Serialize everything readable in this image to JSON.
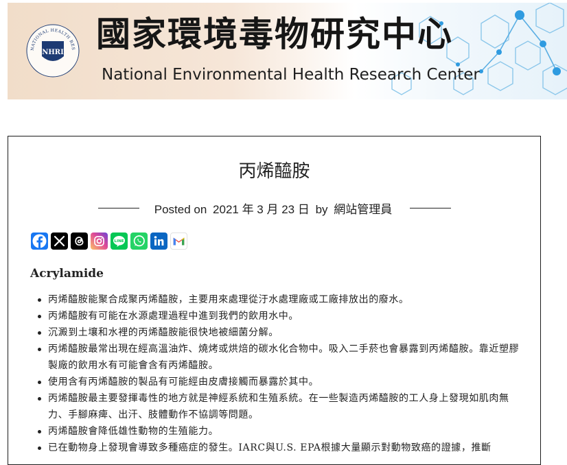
{
  "header": {
    "title_zh": "國家環境毒物研究中心",
    "title_en": "National Environmental Health Research Center",
    "logo": {
      "ring_text": "NATIONAL HEALTH RESEARCH INSTITUTES",
      "monogram": "NHRI",
      "icon": "institute-seal-icon"
    }
  },
  "post": {
    "title": "丙烯醯胺",
    "meta": {
      "posted_on": "Posted on",
      "date": "2021 年 3 月 23 日",
      "by": "by",
      "author": "網站管理員"
    },
    "share_buttons": [
      {
        "name": "facebook",
        "icon": "facebook-icon",
        "color": "#1877f2",
        "glyph": "f"
      },
      {
        "name": "x",
        "icon": "x-icon",
        "color": "#000000",
        "glyph": "𝕏"
      },
      {
        "name": "threads",
        "icon": "threads-icon",
        "color": "#000000",
        "glyph": "@"
      },
      {
        "name": "instagram",
        "icon": "instagram-icon",
        "color": "#d6249f",
        "glyph": "◎"
      },
      {
        "name": "line",
        "icon": "line-icon",
        "color": "#06c755",
        "glyph": "LINE"
      },
      {
        "name": "whatsapp",
        "icon": "whatsapp-icon",
        "color": "#25d366",
        "glyph": "✆"
      },
      {
        "name": "linkedin",
        "icon": "linkedin-icon",
        "color": "#0a66c2",
        "glyph": "in"
      },
      {
        "name": "gmail",
        "icon": "gmail-icon",
        "color": "#ea4335",
        "glyph": "M"
      }
    ],
    "section_heading": "Acrylamide",
    "bullets": [
      "丙烯醯胺能聚合成聚丙烯醯胺，主要用來處理從汙水處理廠或工廠排放出的廢水。",
      "丙烯醯胺有可能在水源處理過程中進到我們的飲用水中。",
      "沉澱到土壤和水裡的丙烯醯胺能很快地被細菌分解。",
      "丙烯醯胺最常出現在經高溫油炸、燒烤或烘焙的碳水化合物中。吸入二手菸也會暴露到丙烯醯胺。靠近塑膠製廠的飲用水有可能會含有丙烯醯胺。",
      "使用含有丙烯醯胺的製品有可能經由皮膚接觸而暴露於其中。",
      "丙烯醯胺最主要發揮毒性的地方就是神經系統和生殖系統。在一些製造丙烯醯胺的工人身上發現如肌肉無力、手腳麻痺、出汗、肢體動作不協調等問題。",
      "丙烯醯胺會降低雄性動物的生殖能力。",
      "已在動物身上發現會導致多種癌症的發生。IARC與U.S. EPA根據大量顯示對動物致癌的證據，推斷"
    ]
  }
}
